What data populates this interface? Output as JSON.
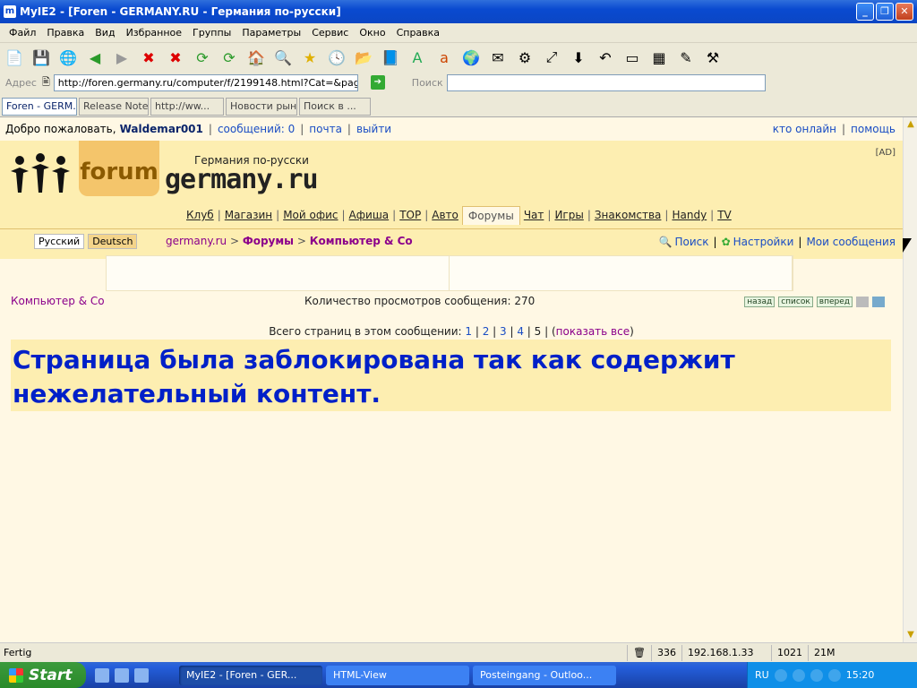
{
  "window": {
    "title": "MyIE2 - [Foren - GERMANY.RU - Германия по-русски]"
  },
  "menu": [
    "Файл",
    "Правка",
    "Вид",
    "Избранное",
    "Группы",
    "Параметры",
    "Сервис",
    "Окно",
    "Справка"
  ],
  "address": {
    "label": "Адрес",
    "url": "http://foren.germany.ru/computer/f/2199148.html?Cat=&page",
    "search_label": "Поиск"
  },
  "tabs": [
    {
      "label": "Foren - GERM..."
    },
    {
      "label": "Release Notes"
    },
    {
      "label": "http://ww..."
    },
    {
      "label": "Новости рын..."
    },
    {
      "label": "Поиск в ..."
    }
  ],
  "userbar": {
    "welcome": "Добро пожаловать,",
    "username": "Waldemar001",
    "messages": "сообщений: 0",
    "mail": "почта",
    "logout": "выйти",
    "who_online": "кто онлайн",
    "help": "помощь"
  },
  "header": {
    "logo_forum": "forum",
    "logo_sub": "Германия по-русски",
    "logo_main": "germany.ru",
    "ad": "[AD]"
  },
  "nav": [
    "Клуб",
    "Магазин",
    "Мой офис",
    "Афиша",
    "TOP",
    "Авто",
    "Форумы",
    "Чат",
    "Игры",
    "Знакомства",
    "Handy",
    "TV"
  ],
  "nav_active": "Форумы",
  "lang": {
    "ru": "Русский",
    "de": "Deutsch"
  },
  "breadcrumb": {
    "site": "germany.ru",
    "sep": " > ",
    "forums": "Форумы",
    "section": "Компьютер & Co"
  },
  "tools": {
    "search": "Поиск",
    "settings": "Настройки",
    "my_messages": "Мои сообщения"
  },
  "info": {
    "section": "Компьютер & Co",
    "views": "Количество просмотров сообщения: 270",
    "back": "назад",
    "list": "список",
    "forward": "вперед"
  },
  "pages": {
    "label": "Всего страниц в этом сообщении:",
    "p1": "1",
    "p2": "2",
    "p3": "3",
    "p4": "4",
    "p5": "5",
    "show_all": "показать все"
  },
  "blocked_message": "Страница была заблокирована так как содержит нежелательный контент.",
  "status": {
    "text": "Fertig",
    "count": "336",
    "ip": "192.168.1.33",
    "n1": "1021",
    "n2": "21M"
  },
  "taskbar": {
    "start": "Start",
    "tasks": [
      "MyIE2 - [Foren - GER...",
      "HTML-View",
      "Posteingang - Outloo..."
    ],
    "lang": "RU",
    "time": "15:20"
  }
}
